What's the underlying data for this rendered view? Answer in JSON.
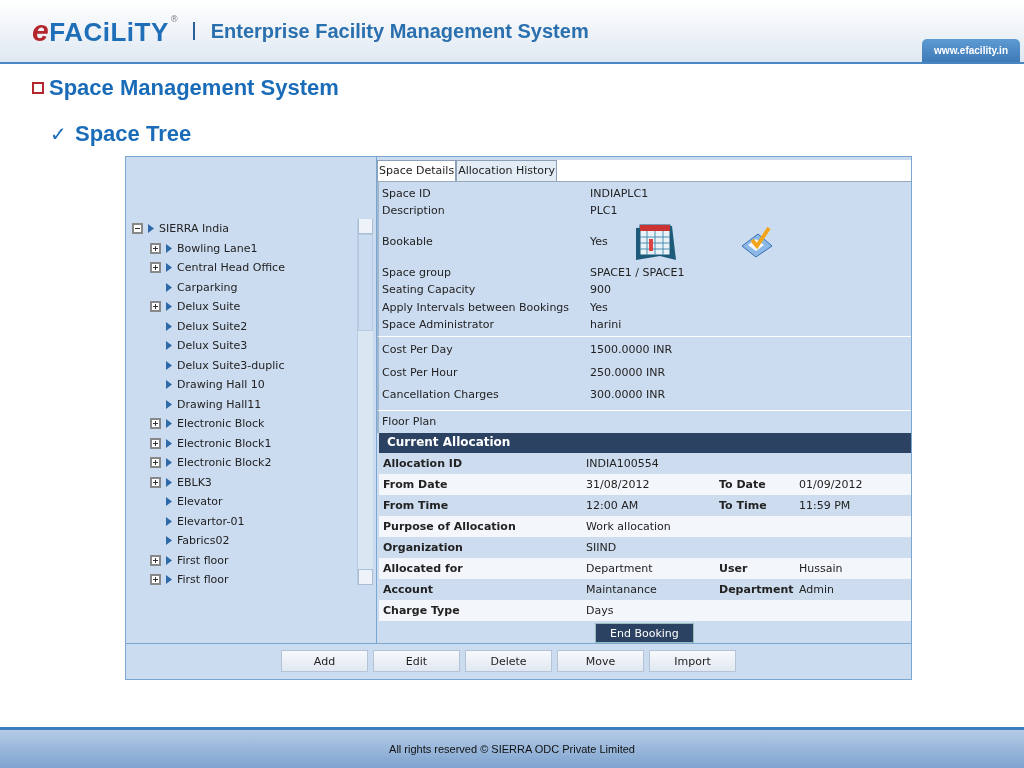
{
  "header": {
    "logo": "eFACiLiTY",
    "logo_mark": "®",
    "title": "Enterprise Facility Management System",
    "url": "www.efacility.in"
  },
  "heading": "Space Management System",
  "subheading": {
    "mark": "✓",
    "text": "Space Tree"
  },
  "tree": {
    "items": [
      {
        "label": "SIERRA India",
        "kind": "branch",
        "expanded": true,
        "children": [
          {
            "label": "Bowling Lane1",
            "kind": "branch",
            "expanded": false
          },
          {
            "label": "Central Head Office",
            "kind": "branch",
            "expanded": false
          },
          {
            "label": "Carparking",
            "kind": "leaf"
          },
          {
            "label": "Delux Suite",
            "kind": "branch",
            "expanded": false
          },
          {
            "label": "Delux Suite2",
            "kind": "leaf"
          },
          {
            "label": "Delux Suite3",
            "kind": "leaf"
          },
          {
            "label": "Delux Suite3-duplic",
            "kind": "leaf"
          },
          {
            "label": "Drawing Hall 10",
            "kind": "leaf"
          },
          {
            "label": "Drawing Hall11",
            "kind": "leaf"
          },
          {
            "label": "Electronic Block",
            "kind": "branch",
            "expanded": false
          },
          {
            "label": "Electronic Block1",
            "kind": "branch",
            "expanded": false
          },
          {
            "label": "Electronic Block2",
            "kind": "branch",
            "expanded": false
          },
          {
            "label": "EBLK3",
            "kind": "branch",
            "expanded": false
          },
          {
            "label": "Elevator",
            "kind": "leaf"
          },
          {
            "label": "Elevartor-01",
            "kind": "leaf"
          },
          {
            "label": "Fabrics02",
            "kind": "leaf"
          },
          {
            "label": "First floor",
            "kind": "branch",
            "expanded": false
          },
          {
            "label": "First floor",
            "kind": "branch",
            "expanded": false
          }
        ]
      }
    ]
  },
  "tabs": [
    {
      "label": "Space Details",
      "selected": true
    },
    {
      "label": "Allocation History",
      "selected": false
    }
  ],
  "details": {
    "sections": [
      {
        "rows": [
          {
            "label": "Space ID",
            "value": "INDIAPLC1",
            "kind": "text"
          },
          {
            "label": "Description",
            "value": "PLC1",
            "kind": "text"
          },
          {
            "label": "Bookable",
            "value": "Yes",
            "kind": "icons"
          },
          {
            "label": "Space group",
            "value": "SPACE1 / SPACE1",
            "kind": "text"
          },
          {
            "label": "Seating Capacity",
            "value": "900",
            "kind": "text"
          },
          {
            "label": "Apply Intervals between Bookings",
            "value": "Yes",
            "kind": "text"
          },
          {
            "label": "Space Administrator",
            "value": "harini",
            "kind": "text"
          }
        ]
      },
      {
        "rows": [
          {
            "label": "Cost Per Day",
            "value": "1500.0000 INR",
            "kind": "text"
          },
          {
            "label": "Cost Per Hour",
            "value": "250.0000 INR",
            "kind": "text"
          },
          {
            "label": "Cancellation Charges",
            "value": "300.0000 INR",
            "kind": "text"
          }
        ]
      }
    ],
    "floor_plan": "Floor Plan"
  },
  "allocation": {
    "title": "Current Allocation",
    "rows": [
      {
        "label": "Allocation ID",
        "value": "INDIA100554"
      },
      {
        "label": "From Date",
        "value": "31/08/2012",
        "label_2": "To Date",
        "value_2": "01/09/2012"
      },
      {
        "label": "From Time",
        "value": "12:00 AM",
        "label_2": "To Time",
        "value_2": "11:59 PM"
      },
      {
        "label": "Purpose of Allocation",
        "value": "Work allocation"
      },
      {
        "label": "Organization",
        "value": "SIIND"
      },
      {
        "label": "Allocated for",
        "value": "Department",
        "label_2": "User",
        "value_2": "Hussain"
      },
      {
        "label": "Account",
        "value": "Maintanance",
        "label_2": "Department",
        "value_2": "Admin"
      },
      {
        "label": "Charge Type",
        "value": "Days"
      }
    ],
    "action": "End Booking"
  },
  "buttons": [
    "Add",
    "Edit",
    "Delete",
    "Move",
    "Import"
  ],
  "footer": "All rights reserved © SIERRA ODC Private Limited"
}
